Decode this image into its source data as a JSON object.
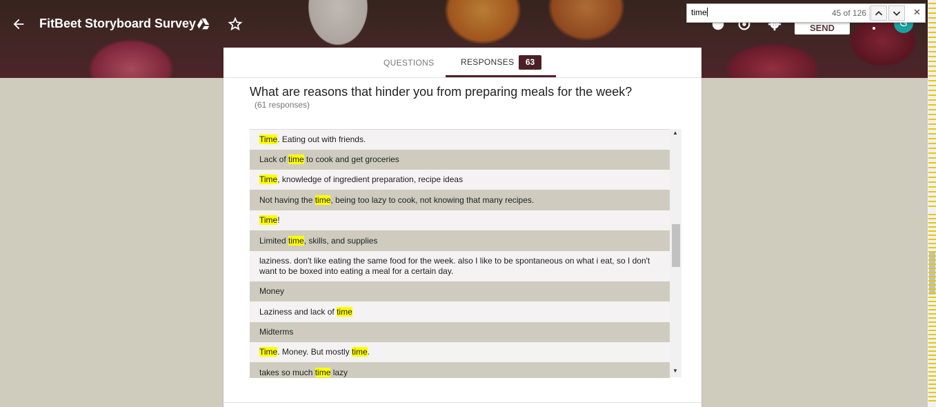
{
  "header": {
    "title": "FitBeet Storyboard Survey",
    "send_label": "SEND",
    "avatar_letter": "G",
    "icons": [
      "back-arrow-icon",
      "drive-add-icon",
      "star-icon",
      "palette-icon",
      "preview-eye-icon",
      "settings-gear-icon",
      "more-vert-icon"
    ]
  },
  "find_bar": {
    "query": "time",
    "count": "45 of 126"
  },
  "tabs": {
    "questions_label": "QUESTIONS",
    "responses_label": "RESPONSES",
    "responses_count": "63"
  },
  "question": {
    "text": "What are reasons that hinder you from preparing meals for the week?",
    "response_count": "(61 responses)"
  },
  "responses": [
    [
      [
        "Time",
        true
      ],
      [
        ". Eating out with friends.",
        false
      ]
    ],
    [
      [
        "Lack of ",
        false
      ],
      [
        "time",
        true
      ],
      [
        " to cook and get groceries",
        false
      ]
    ],
    [
      [
        "Time",
        true
      ],
      [
        ", knowledge of ingredient preparation, recipe ideas",
        false
      ]
    ],
    [
      [
        "Not having the ",
        false
      ],
      [
        "time",
        true
      ],
      [
        ", being too lazy to cook, not knowing that many recipes.",
        false
      ]
    ],
    [
      [
        "Time",
        true
      ],
      [
        "!",
        false
      ]
    ],
    [
      [
        "Limited ",
        false
      ],
      [
        "time",
        true
      ],
      [
        ", skills, and supplies",
        false
      ]
    ],
    [
      [
        "laziness. don't like eating the same food for the week. also I like to be spontaneous on what i eat, so I don't want to be boxed into eating a meal for a certain day.",
        false
      ]
    ],
    [
      [
        "Money",
        false
      ]
    ],
    [
      [
        "Laziness and lack of ",
        false
      ],
      [
        "time",
        true
      ]
    ],
    [
      [
        "Midterms",
        false
      ]
    ],
    [
      [
        "Time",
        true
      ],
      [
        ". Money. But mostly ",
        false
      ],
      [
        "time",
        true
      ],
      [
        ".",
        false
      ]
    ],
    [
      [
        "takes so much ",
        false
      ],
      [
        "time",
        true
      ],
      [
        " lazy",
        false
      ]
    ]
  ],
  "colors": {
    "accent": "#4a2026",
    "highlight": "#ffff00",
    "row_alt": "#cfccbf",
    "row": "#f4f2f2",
    "page_bg": "#cfcbbd"
  }
}
